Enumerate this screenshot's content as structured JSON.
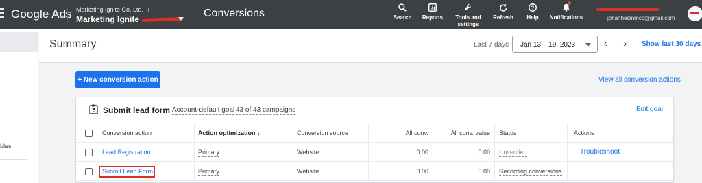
{
  "topbar": {
    "brand": "Google Ads",
    "account_sub": "Marketing Ignite Co. Ltd.",
    "account_main": "Marketing Ignite",
    "page_name": "Conversions",
    "tools": [
      {
        "label": "Search",
        "icon": "search-icon"
      },
      {
        "label": "Reports",
        "icon": "reports-icon"
      },
      {
        "label": "Tools and settings",
        "icon": "wrench-icon"
      },
      {
        "label": "Refresh",
        "icon": "refresh-icon"
      },
      {
        "label": "Help",
        "icon": "help-icon"
      },
      {
        "label": "Notifications",
        "icon": "bell-icon"
      }
    ],
    "user_email": "johanhedinmcc@gmail.com"
  },
  "leftrail": {
    "partial_text": "bles"
  },
  "summary": {
    "title": "Summary",
    "range_label": "Last 7 days",
    "date_range": "Jan 13 – 19, 2023",
    "show_last": "Show last 30 days"
  },
  "actions": {
    "new_conversion": "+ New conversion action",
    "view_all": "View all conversion actions"
  },
  "goal_card": {
    "title": "Submit lead form",
    "goal_type": "Account-default goal",
    "campaigns": "43 of 43 campaigns",
    "edit": "Edit goal",
    "columns": [
      "Conversion action",
      "Action optimization",
      "Conversion source",
      "All conv.",
      "All conv. value",
      "Status",
      "Actions"
    ],
    "rows": [
      {
        "action": "Lead Registration",
        "optimization": "Primary",
        "source": "Website",
        "all_conv": "0.00",
        "all_conv_value": "0.00",
        "status": "Unverified",
        "actions": "Troubleshoot"
      },
      {
        "action": "Submit Lead Form",
        "optimization": "Primary",
        "source": "Website",
        "all_conv": "0.00",
        "all_conv_value": "0.00",
        "status": "Recording conversions",
        "actions": ""
      }
    ]
  },
  "colors": {
    "topbar": "#3c4043",
    "accent": "#1a73e8",
    "highlight": "#d93025"
  }
}
